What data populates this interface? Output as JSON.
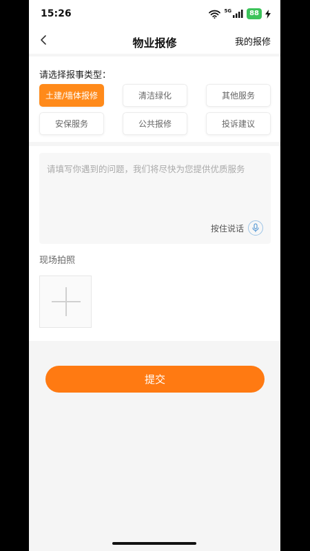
{
  "status": {
    "time": "15:26",
    "network": "5G",
    "battery": "88"
  },
  "nav": {
    "title": "物业报修",
    "right_link": "我的报修"
  },
  "type_section": {
    "label": "请选择报事类型：",
    "chips": [
      {
        "label": "土建/墙体报修",
        "selected": true
      },
      {
        "label": "清洁绿化",
        "selected": false
      },
      {
        "label": "其他服务",
        "selected": false
      },
      {
        "label": "安保服务",
        "selected": false
      },
      {
        "label": "公共报修",
        "selected": false
      },
      {
        "label": "投诉建议",
        "selected": false
      }
    ]
  },
  "description": {
    "placeholder": "请填写你遇到的问题，我们将尽快为您提供优质服务",
    "voice_label": "按住说话"
  },
  "photos": {
    "label": "现场拍照"
  },
  "submit_label": "提交",
  "colors": {
    "accent": "#ff8a1a",
    "submit": "#ff7a12",
    "battery": "#3cc35a"
  }
}
